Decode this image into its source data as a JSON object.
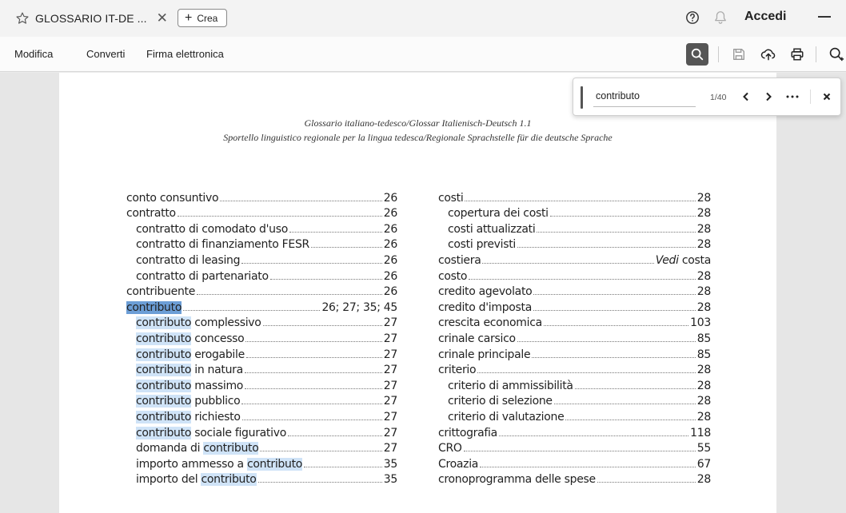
{
  "tab": {
    "title": "GLOSSARIO IT-DE ...",
    "close": "✕"
  },
  "new_button": {
    "plus": "+",
    "label": "Crea"
  },
  "topbar": {
    "signin": "Accedi"
  },
  "menu": [
    "Modifica",
    "Converti",
    "Firma elettronica"
  ],
  "find": {
    "value": "contributo",
    "count": "1/40"
  },
  "document": {
    "header_line1": "Glossario italiano-tedesco/Glossar Italienisch-Deutsch 1.1",
    "header_line2": "Sportello linguistico regionale per la lingua tedesca/Regionale Sprachstelle für die deutsche Sprache",
    "left_column": [
      {
        "term": "conto consuntivo",
        "page": "26",
        "sub": false
      },
      {
        "term": "contratto",
        "page": "26",
        "sub": false
      },
      {
        "term": "contratto di comodato d'uso",
        "page": "26",
        "sub": true
      },
      {
        "term": "contratto di finanziamento FESR",
        "page": "26",
        "sub": true
      },
      {
        "term": "contratto di leasing",
        "page": "26",
        "sub": true
      },
      {
        "term": "contratto di partenariato",
        "page": "26",
        "sub": true
      },
      {
        "term": "contribuente",
        "page": "26",
        "sub": false
      },
      {
        "pre": "",
        "match": "contributo",
        "post": "",
        "page": "26; 27; 35; 45",
        "sub": false,
        "current": true
      },
      {
        "pre": "",
        "match": "contributo",
        "post": " complessivo",
        "page": "27",
        "sub": true
      },
      {
        "pre": "",
        "match": "contributo",
        "post": " concesso",
        "page": "27",
        "sub": true
      },
      {
        "pre": "",
        "match": "contributo",
        "post": " erogabile",
        "page": "27",
        "sub": true
      },
      {
        "pre": "",
        "match": "contributo",
        "post": " in natura",
        "page": "27",
        "sub": true
      },
      {
        "pre": "",
        "match": "contributo",
        "post": " massimo",
        "page": "27",
        "sub": true
      },
      {
        "pre": "",
        "match": "contributo",
        "post": " pubblico",
        "page": "27",
        "sub": true
      },
      {
        "pre": "",
        "match": "contributo",
        "post": " richiesto",
        "page": "27",
        "sub": true
      },
      {
        "pre": "",
        "match": "contributo",
        "post": " sociale figurativo",
        "page": "27",
        "sub": true
      },
      {
        "pre": "domanda di ",
        "match": "contributo",
        "post": "",
        "page": "27",
        "sub": true
      },
      {
        "pre": "importo ammesso a ",
        "match": "contributo",
        "post": "",
        "page": "35",
        "sub": true
      },
      {
        "pre": "importo del ",
        "match": "contributo",
        "post": "",
        "page": "35",
        "sub": true
      }
    ],
    "right_column": [
      {
        "term": "costi",
        "page": "28",
        "sub": false
      },
      {
        "term": "copertura dei costi",
        "page": "28",
        "sub": true
      },
      {
        "term": "costi attualizzati",
        "page": "28",
        "sub": true
      },
      {
        "term": "costi previsti",
        "page": "28",
        "sub": true
      },
      {
        "term": "costiera",
        "see": "Vedi",
        "page": "costa",
        "sub": false
      },
      {
        "term": "costo",
        "page": "28",
        "sub": false
      },
      {
        "term": "credito agevolato",
        "page": "28",
        "sub": false
      },
      {
        "term": "credito d'imposta",
        "page": "28",
        "sub": false
      },
      {
        "term": "crescita economica",
        "page": "103",
        "sub": false
      },
      {
        "term": "crinale carsico",
        "page": "85",
        "sub": false
      },
      {
        "term": "crinale principale",
        "page": "85",
        "sub": false
      },
      {
        "term": "criterio",
        "page": "28",
        "sub": false
      },
      {
        "term": "criterio di ammissibilità",
        "page": "28",
        "sub": true
      },
      {
        "term": "criterio di selezione",
        "page": "28",
        "sub": true
      },
      {
        "term": "criterio di valutazione",
        "page": "28",
        "sub": true
      },
      {
        "term": "crittografia",
        "page": "118",
        "sub": false
      },
      {
        "term": "CRO",
        "page": "55",
        "sub": false
      },
      {
        "term": "Croazia",
        "page": "67",
        "sub": false
      },
      {
        "term": "cronoprogramma delle spese",
        "page": "28",
        "sub": false
      }
    ]
  }
}
